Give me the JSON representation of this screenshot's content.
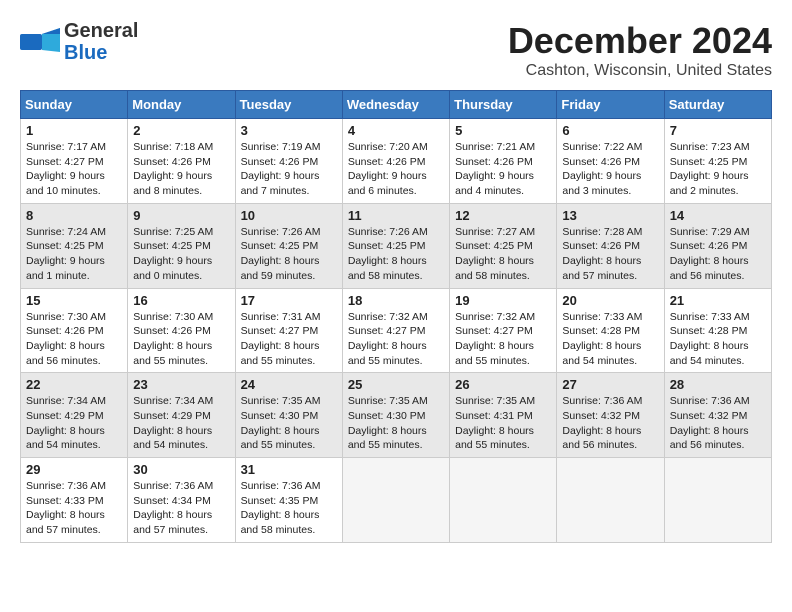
{
  "header": {
    "logo_line1": "General",
    "logo_line2": "Blue",
    "month": "December 2024",
    "location": "Cashton, Wisconsin, United States"
  },
  "days_of_week": [
    "Sunday",
    "Monday",
    "Tuesday",
    "Wednesday",
    "Thursday",
    "Friday",
    "Saturday"
  ],
  "weeks": [
    [
      {
        "num": "1",
        "info": "Sunrise: 7:17 AM\nSunset: 4:27 PM\nDaylight: 9 hours\nand 10 minutes.",
        "empty": false,
        "shaded": false
      },
      {
        "num": "2",
        "info": "Sunrise: 7:18 AM\nSunset: 4:26 PM\nDaylight: 9 hours\nand 8 minutes.",
        "empty": false,
        "shaded": false
      },
      {
        "num": "3",
        "info": "Sunrise: 7:19 AM\nSunset: 4:26 PM\nDaylight: 9 hours\nand 7 minutes.",
        "empty": false,
        "shaded": false
      },
      {
        "num": "4",
        "info": "Sunrise: 7:20 AM\nSunset: 4:26 PM\nDaylight: 9 hours\nand 6 minutes.",
        "empty": false,
        "shaded": false
      },
      {
        "num": "5",
        "info": "Sunrise: 7:21 AM\nSunset: 4:26 PM\nDaylight: 9 hours\nand 4 minutes.",
        "empty": false,
        "shaded": false
      },
      {
        "num": "6",
        "info": "Sunrise: 7:22 AM\nSunset: 4:26 PM\nDaylight: 9 hours\nand 3 minutes.",
        "empty": false,
        "shaded": false
      },
      {
        "num": "7",
        "info": "Sunrise: 7:23 AM\nSunset: 4:25 PM\nDaylight: 9 hours\nand 2 minutes.",
        "empty": false,
        "shaded": false
      }
    ],
    [
      {
        "num": "8",
        "info": "Sunrise: 7:24 AM\nSunset: 4:25 PM\nDaylight: 9 hours\nand 1 minute.",
        "empty": false,
        "shaded": true
      },
      {
        "num": "9",
        "info": "Sunrise: 7:25 AM\nSunset: 4:25 PM\nDaylight: 9 hours\nand 0 minutes.",
        "empty": false,
        "shaded": true
      },
      {
        "num": "10",
        "info": "Sunrise: 7:26 AM\nSunset: 4:25 PM\nDaylight: 8 hours\nand 59 minutes.",
        "empty": false,
        "shaded": true
      },
      {
        "num": "11",
        "info": "Sunrise: 7:26 AM\nSunset: 4:25 PM\nDaylight: 8 hours\nand 58 minutes.",
        "empty": false,
        "shaded": true
      },
      {
        "num": "12",
        "info": "Sunrise: 7:27 AM\nSunset: 4:25 PM\nDaylight: 8 hours\nand 58 minutes.",
        "empty": false,
        "shaded": true
      },
      {
        "num": "13",
        "info": "Sunrise: 7:28 AM\nSunset: 4:26 PM\nDaylight: 8 hours\nand 57 minutes.",
        "empty": false,
        "shaded": true
      },
      {
        "num": "14",
        "info": "Sunrise: 7:29 AM\nSunset: 4:26 PM\nDaylight: 8 hours\nand 56 minutes.",
        "empty": false,
        "shaded": true
      }
    ],
    [
      {
        "num": "15",
        "info": "Sunrise: 7:30 AM\nSunset: 4:26 PM\nDaylight: 8 hours\nand 56 minutes.",
        "empty": false,
        "shaded": false
      },
      {
        "num": "16",
        "info": "Sunrise: 7:30 AM\nSunset: 4:26 PM\nDaylight: 8 hours\nand 55 minutes.",
        "empty": false,
        "shaded": false
      },
      {
        "num": "17",
        "info": "Sunrise: 7:31 AM\nSunset: 4:27 PM\nDaylight: 8 hours\nand 55 minutes.",
        "empty": false,
        "shaded": false
      },
      {
        "num": "18",
        "info": "Sunrise: 7:32 AM\nSunset: 4:27 PM\nDaylight: 8 hours\nand 55 minutes.",
        "empty": false,
        "shaded": false
      },
      {
        "num": "19",
        "info": "Sunrise: 7:32 AM\nSunset: 4:27 PM\nDaylight: 8 hours\nand 55 minutes.",
        "empty": false,
        "shaded": false
      },
      {
        "num": "20",
        "info": "Sunrise: 7:33 AM\nSunset: 4:28 PM\nDaylight: 8 hours\nand 54 minutes.",
        "empty": false,
        "shaded": false
      },
      {
        "num": "21",
        "info": "Sunrise: 7:33 AM\nSunset: 4:28 PM\nDaylight: 8 hours\nand 54 minutes.",
        "empty": false,
        "shaded": false
      }
    ],
    [
      {
        "num": "22",
        "info": "Sunrise: 7:34 AM\nSunset: 4:29 PM\nDaylight: 8 hours\nand 54 minutes.",
        "empty": false,
        "shaded": true
      },
      {
        "num": "23",
        "info": "Sunrise: 7:34 AM\nSunset: 4:29 PM\nDaylight: 8 hours\nand 54 minutes.",
        "empty": false,
        "shaded": true
      },
      {
        "num": "24",
        "info": "Sunrise: 7:35 AM\nSunset: 4:30 PM\nDaylight: 8 hours\nand 55 minutes.",
        "empty": false,
        "shaded": true
      },
      {
        "num": "25",
        "info": "Sunrise: 7:35 AM\nSunset: 4:30 PM\nDaylight: 8 hours\nand 55 minutes.",
        "empty": false,
        "shaded": true
      },
      {
        "num": "26",
        "info": "Sunrise: 7:35 AM\nSunset: 4:31 PM\nDaylight: 8 hours\nand 55 minutes.",
        "empty": false,
        "shaded": true
      },
      {
        "num": "27",
        "info": "Sunrise: 7:36 AM\nSunset: 4:32 PM\nDaylight: 8 hours\nand 56 minutes.",
        "empty": false,
        "shaded": true
      },
      {
        "num": "28",
        "info": "Sunrise: 7:36 AM\nSunset: 4:32 PM\nDaylight: 8 hours\nand 56 minutes.",
        "empty": false,
        "shaded": true
      }
    ],
    [
      {
        "num": "29",
        "info": "Sunrise: 7:36 AM\nSunset: 4:33 PM\nDaylight: 8 hours\nand 57 minutes.",
        "empty": false,
        "shaded": false
      },
      {
        "num": "30",
        "info": "Sunrise: 7:36 AM\nSunset: 4:34 PM\nDaylight: 8 hours\nand 57 minutes.",
        "empty": false,
        "shaded": false
      },
      {
        "num": "31",
        "info": "Sunrise: 7:36 AM\nSunset: 4:35 PM\nDaylight: 8 hours\nand 58 minutes.",
        "empty": false,
        "shaded": false
      },
      {
        "num": "",
        "info": "",
        "empty": true,
        "shaded": false
      },
      {
        "num": "",
        "info": "",
        "empty": true,
        "shaded": false
      },
      {
        "num": "",
        "info": "",
        "empty": true,
        "shaded": false
      },
      {
        "num": "",
        "info": "",
        "empty": true,
        "shaded": false
      }
    ]
  ]
}
